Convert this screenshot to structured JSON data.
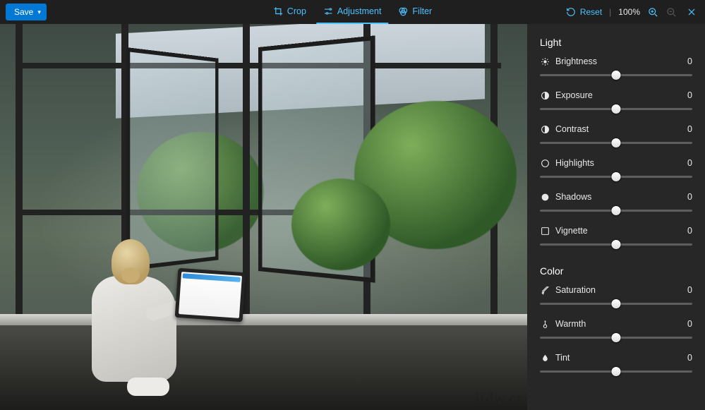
{
  "toolbar": {
    "save_label": "Save",
    "tabs": {
      "crop": "Crop",
      "adjustment": "Adjustment",
      "filter": "Filter"
    },
    "active_tab": "adjustment",
    "reset_label": "Reset",
    "zoom_pct": "100%"
  },
  "panel": {
    "light": {
      "title": "Light",
      "sliders": {
        "brightness": {
          "label": "Brightness",
          "value": 0
        },
        "exposure": {
          "label": "Exposure",
          "value": 0
        },
        "contrast": {
          "label": "Contrast",
          "value": 0
        },
        "highlights": {
          "label": "Highlights",
          "value": 0
        },
        "shadows": {
          "label": "Shadows",
          "value": 0
        },
        "vignette": {
          "label": "Vignette",
          "value": 0
        }
      }
    },
    "color": {
      "title": "Color",
      "sliders": {
        "saturation": {
          "label": "Saturation",
          "value": 0
        },
        "warmth": {
          "label": "Warmth",
          "value": 0
        },
        "tint": {
          "label": "Tint",
          "value": 0
        }
      }
    }
  },
  "watermark": "itdw.cr",
  "colors": {
    "accent": "#4cc2ff",
    "primary_btn": "#0078d4"
  }
}
